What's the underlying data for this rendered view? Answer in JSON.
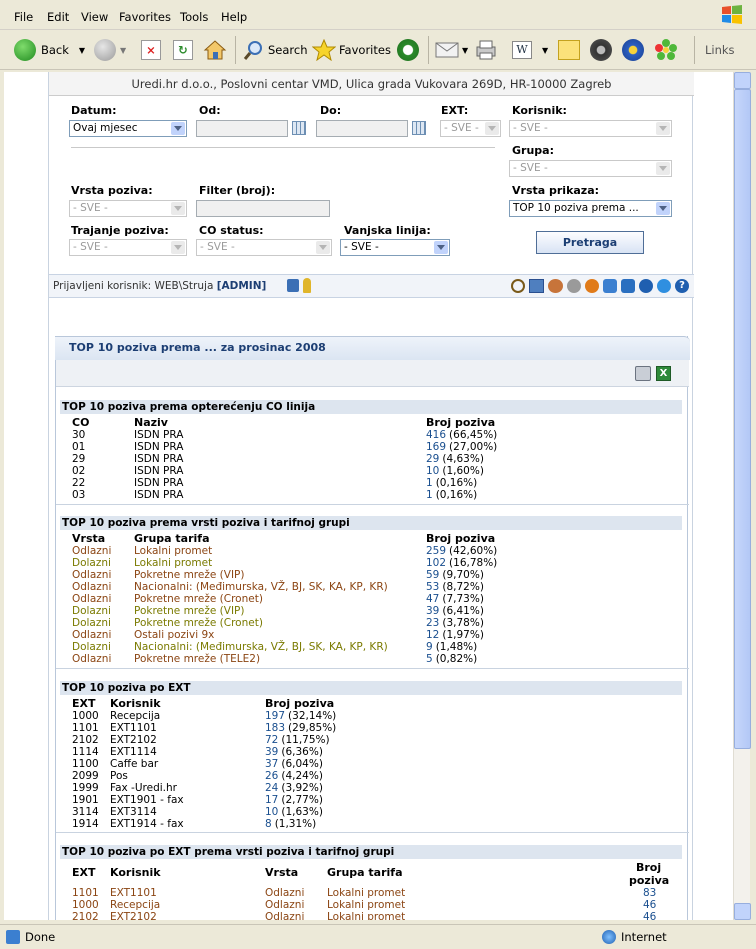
{
  "menu": [
    "File",
    "Edit",
    "View",
    "Favorites",
    "Tools",
    "Help"
  ],
  "toolbar": {
    "back": "Back",
    "search": "Search",
    "favorites": "Favorites",
    "links": "Links"
  },
  "header": {
    "company": "Uredi.hr d.o.o., Poslovni centar VMD, Ulica grada Vukovara 269D, HR-10000 Zagreb"
  },
  "filters": {
    "datum_label": "Datum:",
    "datum_value": "Ovaj mjesec",
    "od_label": "Od:",
    "do_label": "Do:",
    "ext_label": "EXT:",
    "ext_value": "- SVE -",
    "korisnik_label": "Korisnik:",
    "korisnik_value": "- SVE -",
    "grupa_label": "Grupa:",
    "grupa_value": "- SVE -",
    "vrsta_poziva_label": "Vrsta poziva:",
    "vrsta_poziva_value": "- SVE -",
    "filter_broj_label": "Filter (broj):",
    "vrsta_prikaza_label": "Vrsta prikaza:",
    "vrsta_prikaza_value": "TOP 10 poziva prema ...",
    "trajanje_label": "Trajanje poziva:",
    "trajanje_value": "- SVE -",
    "co_status_label": "CO status:",
    "co_status_value": "- SVE -",
    "vanjska_label": "Vanjska linija:",
    "vanjska_value": "- SVE -",
    "search_button": "Pretraga"
  },
  "userbar": {
    "prefix": "Prijavljeni korisnik: WEB\\Struja ",
    "role": "[ADMIN]"
  },
  "panel_title": "TOP 10 poziva prema ... za prosinac 2008",
  "sections": {
    "co": {
      "title": "TOP 10 poziva prema opterećenju CO linija",
      "headers": [
        "CO",
        "Naziv",
        "Broj poziva"
      ],
      "rows": [
        [
          "30",
          "ISDN PRA",
          "416",
          "(66,45%)"
        ],
        [
          "01",
          "ISDN PRA",
          "169",
          "(27,00%)"
        ],
        [
          "29",
          "ISDN PRA",
          "29",
          "(4,63%)"
        ],
        [
          "02",
          "ISDN PRA",
          "10",
          "(1,60%)"
        ],
        [
          "22",
          "ISDN PRA",
          "1",
          "(0,16%)"
        ],
        [
          "03",
          "ISDN PRA",
          "1",
          "(0,16%)"
        ]
      ]
    },
    "vrsta": {
      "title": "TOP 10 poziva prema vrsti poziva i tarifnoj grupi",
      "headers": [
        "Vrsta",
        "Grupa tarifa",
        "Broj poziva"
      ],
      "rows": [
        [
          "Odlazni",
          "Lokalni promet",
          "259",
          "(42,60%)"
        ],
        [
          "Dolazni",
          "Lokalni promet",
          "102",
          "(16,78%)"
        ],
        [
          "Odlazni",
          "Pokretne mreže (VIP)",
          "59",
          "(9,70%)"
        ],
        [
          "Odlazni",
          "Nacionalni: (Međimurska, VŽ, BJ, SK, KA, KP, KR)",
          "53",
          "(8,72%)"
        ],
        [
          "Odlazni",
          "Pokretne mreže (Cronet)",
          "47",
          "(7,73%)"
        ],
        [
          "Dolazni",
          "Pokretne mreže (VIP)",
          "39",
          "(6,41%)"
        ],
        [
          "Dolazni",
          "Pokretne mreže (Cronet)",
          "23",
          "(3,78%)"
        ],
        [
          "Odlazni",
          "Ostali pozivi 9x",
          "12",
          "(1,97%)"
        ],
        [
          "Dolazni",
          "Nacionalni: (Međimurska, VŽ, BJ, SK, KA, KP, KR)",
          "9",
          "(1,48%)"
        ],
        [
          "Odlazni",
          "Pokretne mreže (TELE2)",
          "5",
          "(0,82%)"
        ]
      ]
    },
    "ext": {
      "title": "TOP 10 poziva po EXT",
      "headers": [
        "EXT",
        "Korisnik",
        "Broj poziva"
      ],
      "rows": [
        [
          "1000",
          "Recepcija",
          "197",
          "(32,14%)"
        ],
        [
          "1101",
          "EXT1101",
          "183",
          "(29,85%)"
        ],
        [
          "2102",
          "EXT2102",
          "72",
          "(11,75%)"
        ],
        [
          "1114",
          "EXT1114",
          "39",
          "(6,36%)"
        ],
        [
          "1100",
          "Caffe bar",
          "37",
          "(6,04%)"
        ],
        [
          "2099",
          "Pos",
          "26",
          "(4,24%)"
        ],
        [
          "1999",
          "Fax -Uredi.hr",
          "24",
          "(3,92%)"
        ],
        [
          "1901",
          "EXT1901 - fax",
          "17",
          "(2,77%)"
        ],
        [
          "3114",
          "EXT3114",
          "10",
          "(1,63%)"
        ],
        [
          "1914",
          "EXT1914 - fax",
          "8",
          "(1,31%)"
        ]
      ]
    },
    "extvrsta": {
      "title": "TOP 10 poziva po EXT prema vrsti poziva i tarifnoj grupi",
      "headers": [
        "EXT",
        "Korisnik",
        "Vrsta",
        "Grupa tarifa",
        "Broj",
        "poziva"
      ],
      "rows": [
        [
          "1101",
          "EXT1101",
          "Odlazni",
          "Lokalni promet",
          "83"
        ],
        [
          "1000",
          "Recepcija",
          "Odlazni",
          "Lokalni promet",
          "46"
        ],
        [
          "2102",
          "EXT2102",
          "Odlazni",
          "Lokalni promet",
          "46"
        ]
      ]
    }
  },
  "status": {
    "left": "Done",
    "right": "Internet"
  }
}
